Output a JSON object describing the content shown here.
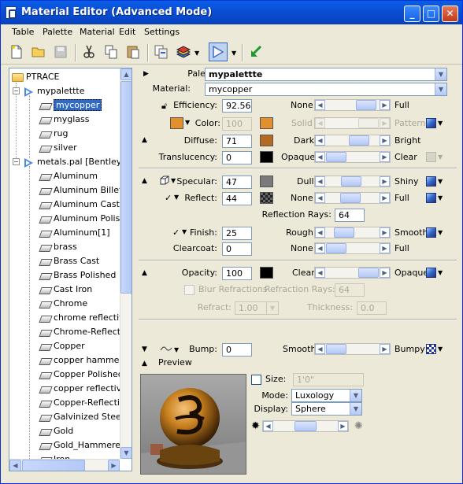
{
  "window": {
    "title": "Material Editor (Advanced Mode)",
    "buttons": [
      "_",
      "□",
      "✕"
    ]
  },
  "menu": [
    "Table",
    "Palette",
    "Material",
    "Edit",
    "Settings"
  ],
  "toolbar": {
    "icons": [
      "new-icon",
      "open-icon",
      "save-icon",
      "cut-icon",
      "copy-icon",
      "paste-icon",
      "copy-material-icon",
      "palette-stack-icon",
      "dropdown-icon",
      "palette-select-icon",
      "dropdown-icon",
      "apply-icon"
    ]
  },
  "tree": {
    "root": "PTRACE",
    "palette1": "mypalettte",
    "palette1_items": [
      "mycopper",
      "myglass",
      "rug",
      "silver"
    ],
    "selected_item": "mycopper",
    "palette2": "metals.pal [Bentley_M",
    "palette2_items": [
      "Aluminum",
      "Aluminum Billet",
      "Aluminum Cast",
      "Aluminum Polishe",
      "Aluminum[1]",
      "brass",
      "Brass Cast",
      "Brass Polished",
      "Cast Iron",
      "Chrome",
      "chrome reflective",
      "Chrome-Reflectiv",
      "Copper",
      "copper hammere",
      "Copper Polished",
      "copper reflective",
      "Copper-Reflectiv",
      "Galvinized Steel",
      "Gold",
      "Gold_Hammered",
      "Iron"
    ]
  },
  "header": {
    "palette_label": "Palette:",
    "palette_value": "mypalettte",
    "material_label": "Material:",
    "material_value": "mycopper"
  },
  "basic": {
    "efficiency_label": "Efficiency:",
    "efficiency_value": "92.56",
    "efficiency_min": "None",
    "efficiency_max": "Full",
    "color_label": "Color:",
    "color_value": "100",
    "color_min": "Solid",
    "color_max": "Pattern",
    "diffuse_label": "Diffuse:",
    "diffuse_value": "71",
    "diffuse_min": "Dark",
    "diffuse_max": "Bright",
    "translucency_label": "Translucency:",
    "translucency_value": "0",
    "translucency_min": "Opaque",
    "translucency_max": "Clear"
  },
  "specular": {
    "specular_label": "Specular:",
    "specular_value": "47",
    "specular_min": "Dull",
    "specular_max": "Shiny",
    "reflect_label": "Reflect:",
    "reflect_value": "44",
    "reflect_min": "None",
    "reflect_max": "Full",
    "rays_label": "Reflection Rays:",
    "rays_value": "64",
    "finish_label": "Finish:",
    "finish_value": "25",
    "finish_min": "Rough",
    "finish_max": "Smooth",
    "clearcoat_label": "Clearcoat:",
    "clearcoat_value": "0",
    "clearcoat_min": "None",
    "clearcoat_max": "Full"
  },
  "opacity": {
    "opacity_label": "Opacity:",
    "opacity_value": "100",
    "opacity_min": "Clear",
    "opacity_max": "Opaque",
    "blur_label": "Blur Refractions",
    "refraction_rays_label": "Refraction Rays:",
    "refraction_rays_value": "64",
    "refract_label": "Refract:",
    "refract_value": "1.00",
    "thickness_label": "Thickness:",
    "thickness_value": "0.0"
  },
  "bump": {
    "bump_label": "Bump:",
    "bump_value": "0",
    "bump_min": "Smooth",
    "bump_max": "Bumpy"
  },
  "preview": {
    "label": "Preview",
    "size_label": "Size:",
    "size_value": "1'0\"",
    "mode_label": "Mode:",
    "mode_value": "Luxology",
    "display_label": "Display:",
    "display_value": "Sphere"
  },
  "colors": {
    "copper": "#e2902e",
    "diffuse_swatch": "#b36a22",
    "black": "#000000",
    "specular_swatch": "#7a7a7a",
    "selection": "#316ac5",
    "titlebar": "#0a4fd4"
  },
  "levels": {
    "efficiency": 0.93,
    "color": 1.0,
    "diffuse": 0.71,
    "translucency": 0.0,
    "specular": 0.47,
    "reflect": 0.44,
    "finish": 0.25,
    "clearcoat": 0.0,
    "opacity": 1.0,
    "bump": 0.0
  }
}
